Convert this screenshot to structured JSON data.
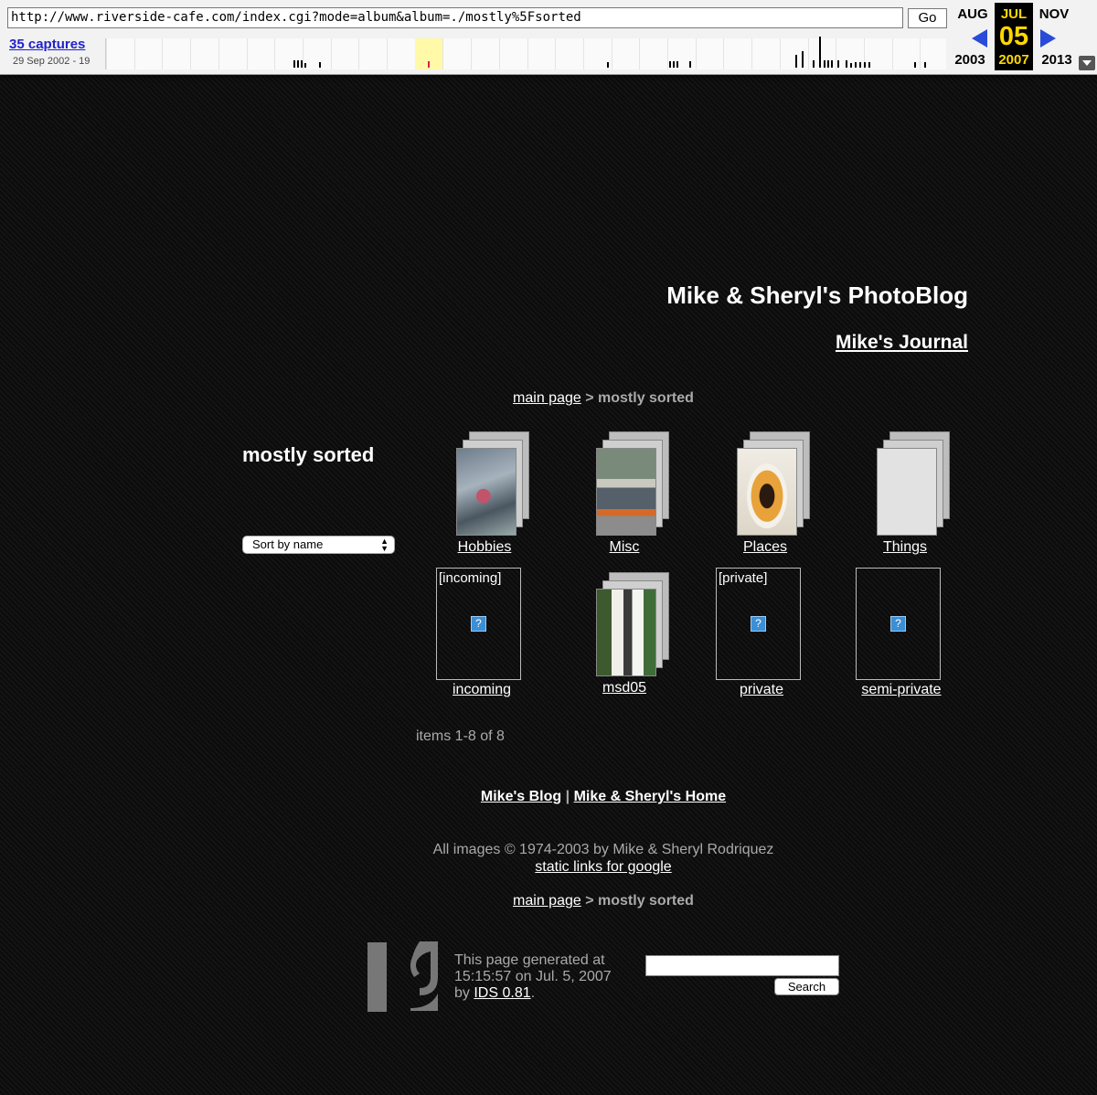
{
  "wayback": {
    "url": "http://www.riverside-cafe.com/index.cgi?mode=album&album=./mostly%5Fsorted",
    "go_label": "Go",
    "captures": "35 captures",
    "range": "29 Sep 2002 - 19",
    "prev_month": "AUG",
    "cur_month": "JUL",
    "next_month": "NOV",
    "prev_year": "2003",
    "cur_year": "2007",
    "next_year": "2013",
    "day": "05",
    "colors": {
      "highlight": "#fff9a8",
      "current_bg": "#000000",
      "current_text": "#ffd700",
      "arrow": "#2a4bd7"
    }
  },
  "site": {
    "title": "Mike & Sheryl's PhotoBlog",
    "journal_link": "Mike's Journal"
  },
  "breadcrumb": {
    "home": "main page",
    "separator": ">",
    "current": "mostly sorted"
  },
  "album": {
    "title": "mostly sorted",
    "sort_label": "Sort by name",
    "items": [
      {
        "label": "Hobbies",
        "type": "album"
      },
      {
        "label": "Misc",
        "type": "album"
      },
      {
        "label": "Places",
        "type": "album"
      },
      {
        "label": "Things",
        "type": "album"
      },
      {
        "label": "incoming",
        "type": "restricted",
        "tag": "[incoming]",
        "icon": "broken-image-icon"
      },
      {
        "label": "msd05",
        "type": "album"
      },
      {
        "label": "private",
        "type": "restricted",
        "tag": "[private]",
        "icon": "broken-image-icon"
      },
      {
        "label": "semi-private",
        "type": "restricted",
        "tag": "",
        "icon": "broken-image-icon"
      }
    ],
    "items_count": "items 1-8 of 8"
  },
  "footer": {
    "blog_link": "Mike's Blog",
    "separator": "|",
    "home_link": "Mike & Sheryl's Home",
    "copyright": "All images © 1974-2003 by Mike & Sheryl Rodriquez",
    "static_links": "static links for google",
    "generated_line1": "This page generated at",
    "generated_line2": "15:15:57 on Jul. 5, 2007",
    "generated_by": "by",
    "generator": "IDS 0.81",
    "generator_suffix": "."
  },
  "search": {
    "value": "",
    "button_label": "Search"
  }
}
